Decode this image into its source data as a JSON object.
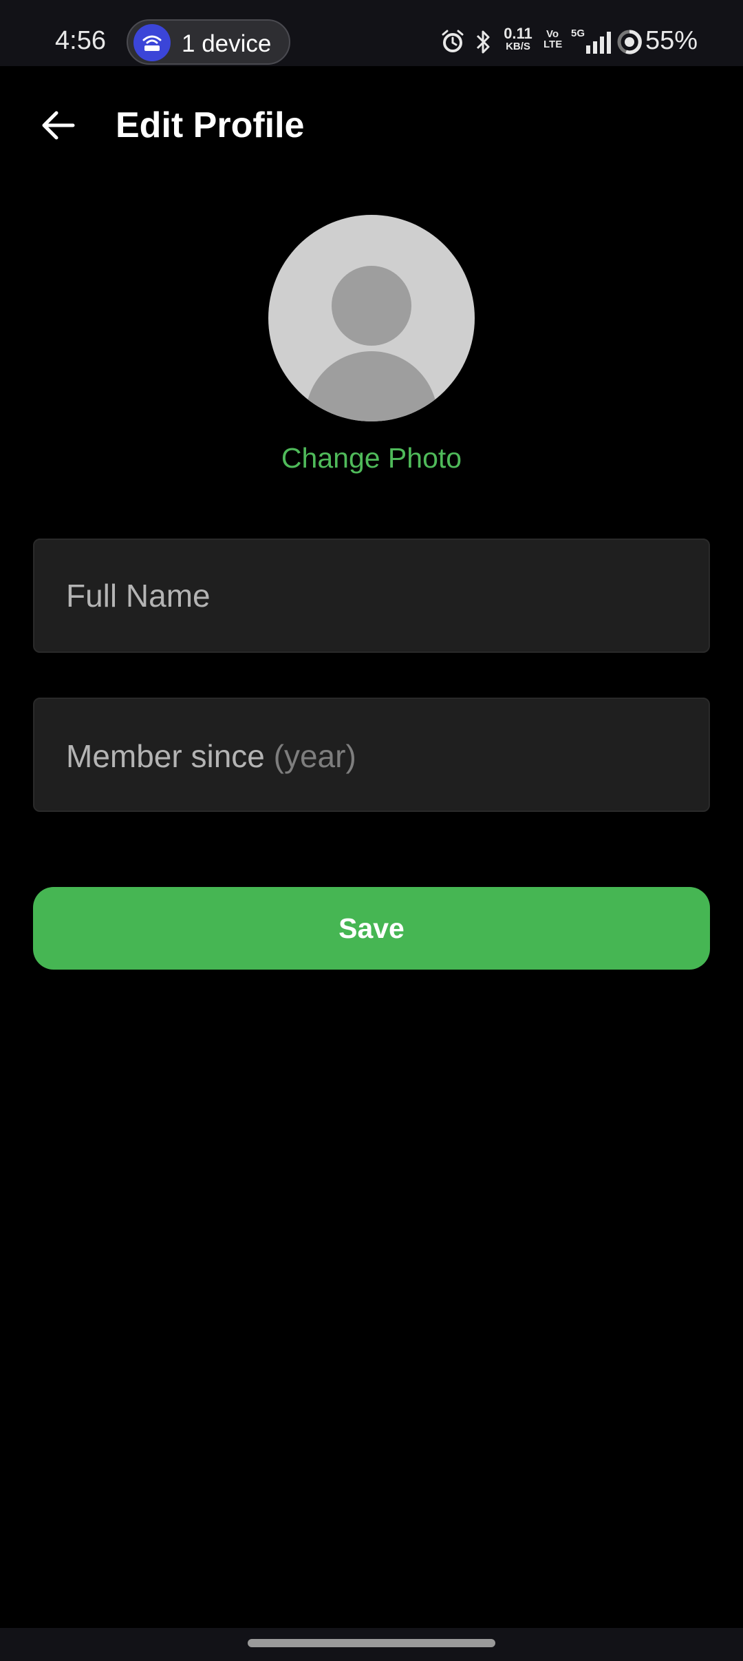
{
  "status_bar": {
    "time": "4:56",
    "hotspot_label": "1 device",
    "net_speed_value": "0.11",
    "net_speed_unit": "KB/S",
    "volte_top": "Vo",
    "volte_bottom": "LTE",
    "network_type": "5G",
    "battery_percent": "55%",
    "icons": [
      "alarm-icon",
      "bluetooth-icon",
      "signal-icon",
      "battery-icon",
      "hotspot-icon"
    ]
  },
  "app_bar": {
    "title": "Edit Profile",
    "back_icon": "arrow-left-icon"
  },
  "profile": {
    "avatar_icon": "default-avatar-icon",
    "change_photo_label": "Change Photo"
  },
  "form": {
    "full_name_placeholder": "Full Name",
    "member_since_label": "Member since",
    "member_since_hint": "(year)",
    "save_label": "Save"
  },
  "colors": {
    "accent_green": "#46b653",
    "link_green": "#4fba5a",
    "background": "#000000",
    "field_background": "#1f1f1f",
    "hotspot_blue": "#3b45d8"
  }
}
